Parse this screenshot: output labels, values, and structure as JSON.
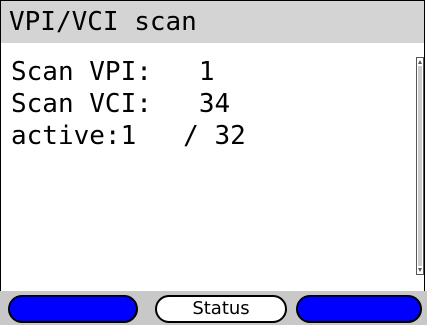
{
  "window": {
    "title": "VPI/VCI scan"
  },
  "content": {
    "lines": [
      "Scan VPI:   1",
      "Scan VCI:   34",
      "active:1   / 32"
    ]
  },
  "softkeys": {
    "left_label": "",
    "middle_label": "Status",
    "right_label": ""
  },
  "colors": {
    "title_bar": "#d4d4d4",
    "softkey_blue": "#0000ff",
    "softkey_white": "#ffffff",
    "softkey_bar": "#c8c8c8"
  },
  "icons": {
    "scroll_up": "scroll-up-arrow-icon",
    "scroll_down": "scroll-down-arrow-icon"
  }
}
